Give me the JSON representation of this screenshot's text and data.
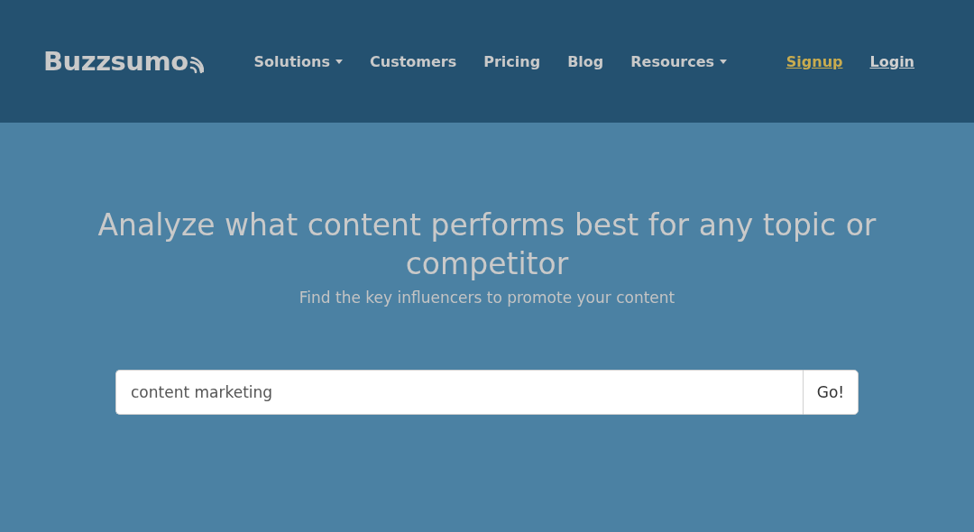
{
  "header": {
    "logo": "Buzzsumo",
    "nav": [
      {
        "label": "Solutions",
        "dropdown": true
      },
      {
        "label": "Customers",
        "dropdown": false
      },
      {
        "label": "Pricing",
        "dropdown": false
      },
      {
        "label": "Blog",
        "dropdown": false
      },
      {
        "label": "Resources",
        "dropdown": true
      }
    ],
    "auth_links": [
      {
        "label": "Signup",
        "highlighted": true
      },
      {
        "label": "Login",
        "highlighted": false
      }
    ]
  },
  "hero": {
    "title": "Analyze what content performs best for any topic or competitor",
    "subtitle": "Find the key influencers to promote your content",
    "search": {
      "value": "content marketing",
      "button": "Go!"
    }
  }
}
